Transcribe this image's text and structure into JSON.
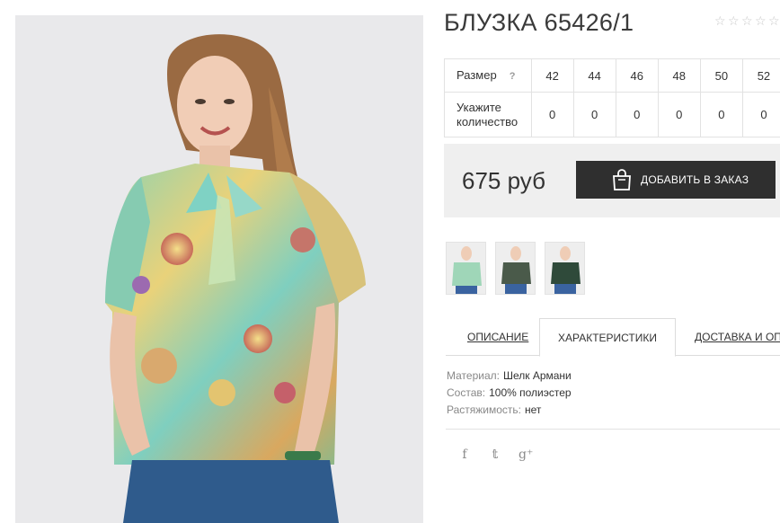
{
  "product": {
    "title": "БЛУЗКА 65426/1",
    "rating_stars": 5,
    "rating_value": 0,
    "price": "675 руб"
  },
  "sizes_table": {
    "size_label": "Размер",
    "help": "?",
    "qty_label": "Укажите количество",
    "sizes": [
      "42",
      "44",
      "46",
      "48",
      "50",
      "52"
    ],
    "quantities": [
      "0",
      "0",
      "0",
      "0",
      "0",
      "0"
    ]
  },
  "order": {
    "add_button_label": "ДОБАВИТЬ В ЗАКАЗ",
    "button_icon": "shopping-bag-icon"
  },
  "tabs": [
    {
      "label": "ОПИСАНИЕ",
      "active": false
    },
    {
      "label": "ХАРАКТЕРИСТИКИ",
      "active": true
    },
    {
      "label": "ДОСТАВКА И ОПЛАТА",
      "active": false
    }
  ],
  "specs": [
    {
      "key": "Материал:",
      "value": "Шелк Армани"
    },
    {
      "key": "Состав:",
      "value": "100% полиэстер"
    },
    {
      "key": "Растяжимость:",
      "value": "нет"
    }
  ],
  "social": [
    {
      "icon": "facebook-icon",
      "glyph": "f"
    },
    {
      "icon": "twitter-icon",
      "glyph": "𝕥"
    },
    {
      "icon": "google-plus-icon",
      "glyph": "g⁺"
    }
  ],
  "colors": {
    "button_bg": "#2f2f2f",
    "order_box_bg": "#efefef",
    "photo_bg": "#e9e9eb"
  }
}
